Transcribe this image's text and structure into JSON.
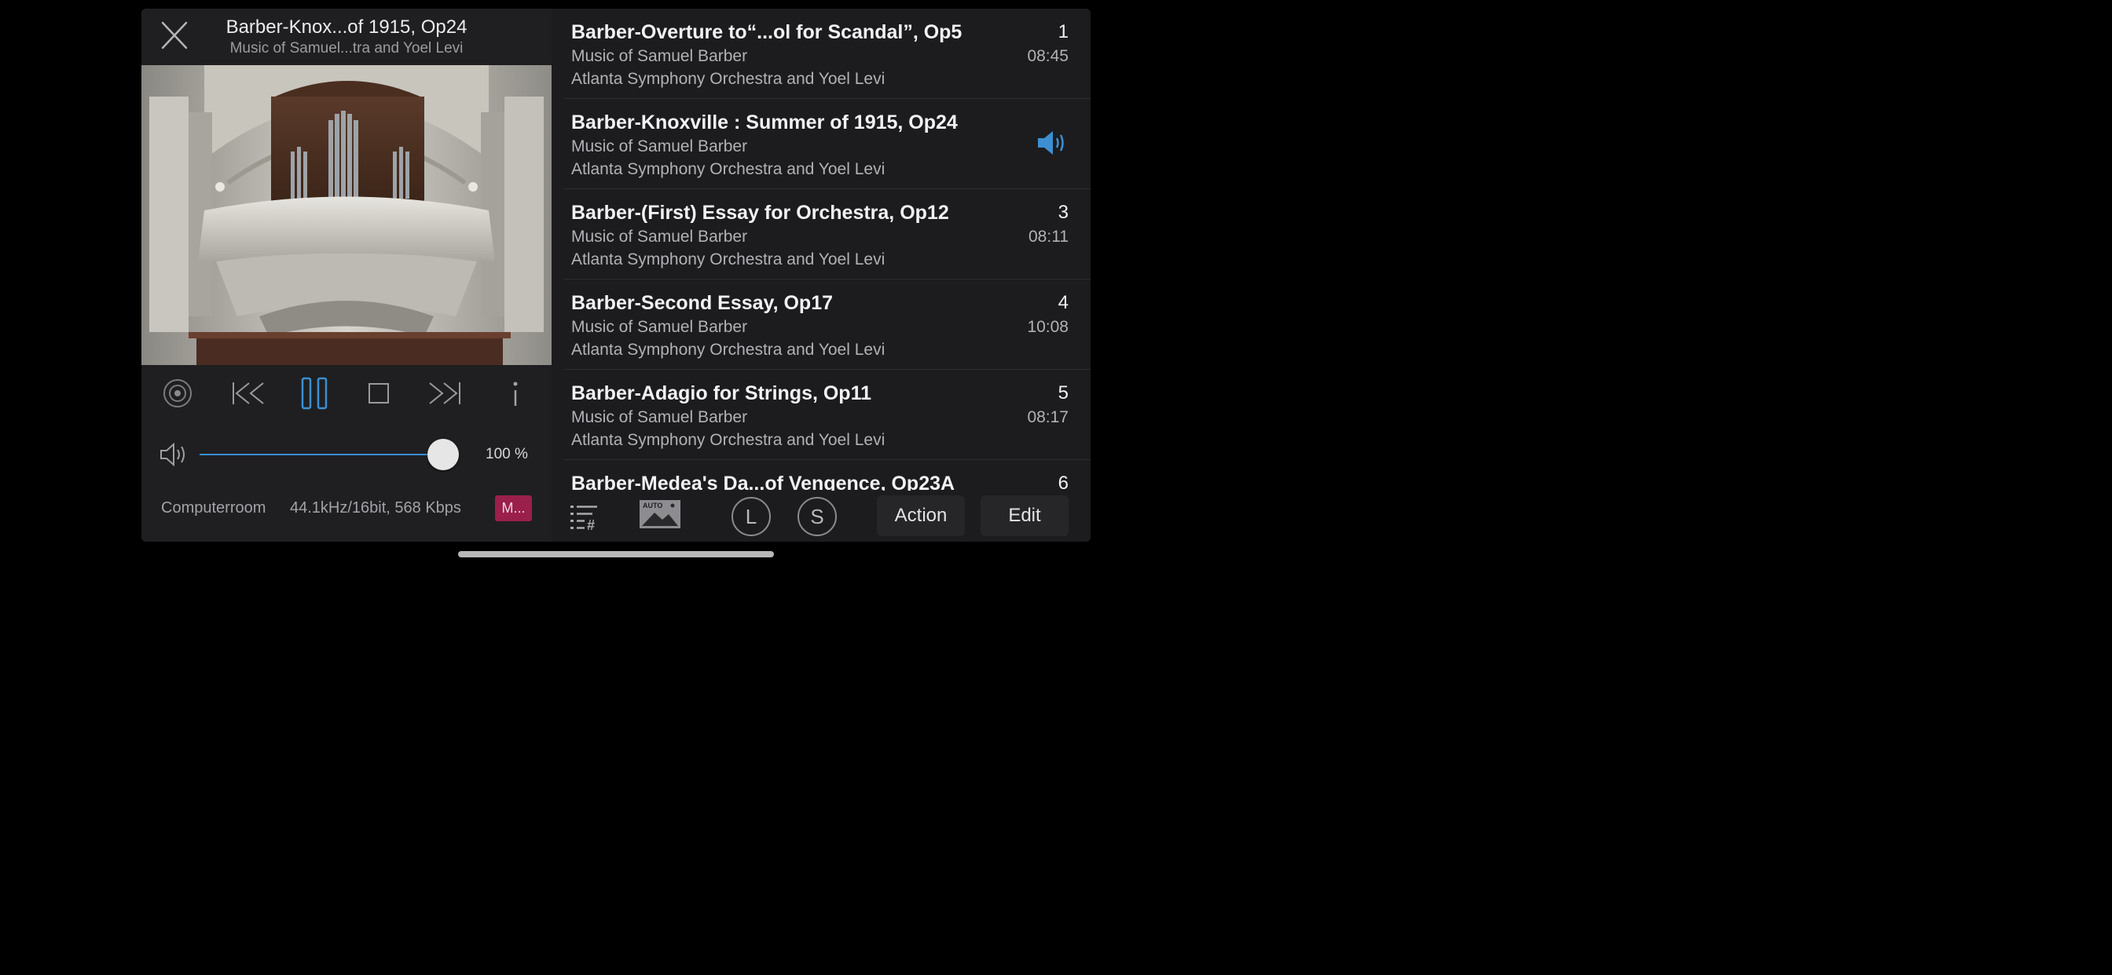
{
  "now_playing": {
    "title": "Barber-Knox...of 1915, Op24",
    "subtitle": "Music of Samuel...tra and Yoel Levi",
    "artwork": "organ-loft-photo"
  },
  "transport": {
    "state": "playing",
    "icons": [
      "radio-icon",
      "previous-icon",
      "pause-icon",
      "stop-icon",
      "next-icon",
      "info-icon"
    ],
    "accent": "#3d8fd1"
  },
  "volume": {
    "level": 1.0,
    "percent_label": "100 %"
  },
  "status": {
    "device": "Computerroom",
    "format": "44.1kHz/16bit, 568 Kbps",
    "badge": "M...",
    "badge_color": "#9a1f4a"
  },
  "tracks": [
    {
      "title": "Barber-Overture to“...ol for Scandal”, Op5",
      "album": "Music of Samuel Barber",
      "artist": "Atlanta Symphony Orchestra and Yoel Levi",
      "number": "1",
      "duration": "08:45",
      "playing": false
    },
    {
      "title": "Barber-Knoxville : Summer of 1915, Op24",
      "album": "Music of Samuel Barber",
      "artist": "Atlanta Symphony Orchestra and Yoel Levi",
      "number": "",
      "duration": "",
      "playing": true
    },
    {
      "title": "Barber-(First) Essay for Orchestra, Op12",
      "album": "Music of Samuel Barber",
      "artist": "Atlanta Symphony Orchestra and Yoel Levi",
      "number": "3",
      "duration": "08:11",
      "playing": false
    },
    {
      "title": "Barber-Second Essay, Op17",
      "album": "Music of Samuel Barber",
      "artist": "Atlanta Symphony Orchestra and Yoel Levi",
      "number": "4",
      "duration": "10:08",
      "playing": false
    },
    {
      "title": "Barber-Adagio for Strings, Op11",
      "album": "Music of Samuel Barber",
      "artist": "Atlanta Symphony Orchestra and Yoel Levi",
      "number": "5",
      "duration": "08:17",
      "playing": false
    },
    {
      "title": "Barber-Medea's Da...of Vengence, Op23A",
      "album": "",
      "artist": "",
      "number": "6",
      "duration": "",
      "playing": false
    }
  ],
  "toolbar": {
    "auto_label": "AUTO",
    "l_label": "L",
    "s_label": "S",
    "action_label": "Action",
    "edit_label": "Edit"
  }
}
